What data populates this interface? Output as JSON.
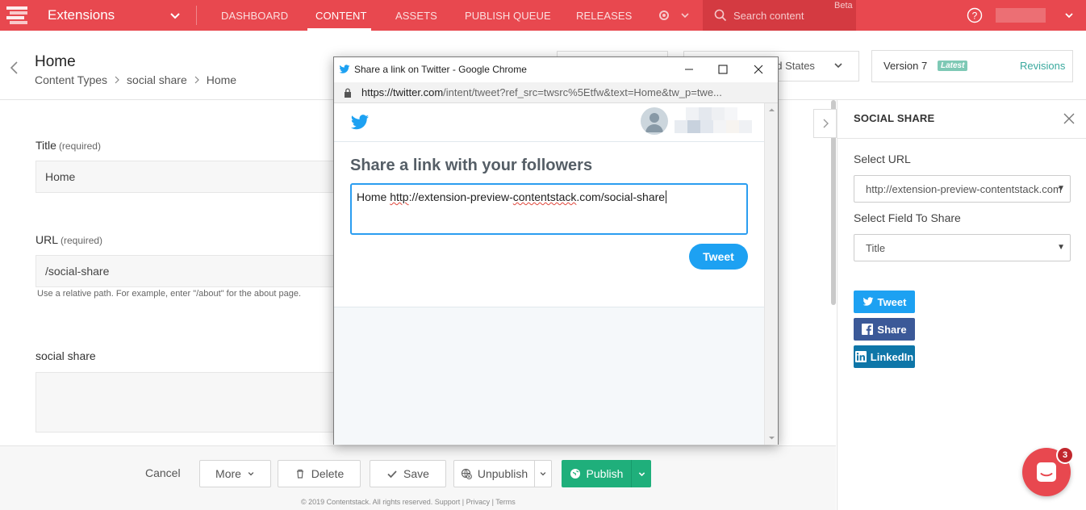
{
  "topnav": {
    "stack_name": "Extensions",
    "items": [
      "DASHBOARD",
      "CONTENT",
      "ASSETS",
      "PUBLISH QUEUE",
      "RELEASES"
    ],
    "active_item": "CONTENT",
    "search_placeholder": "Search content",
    "beta_label": "Beta",
    "brand_color": "#e8484f"
  },
  "header": {
    "title": "Home",
    "breadcrumb": [
      "Content Types",
      "social share",
      "Home"
    ],
    "locale_partial": "ed States",
    "version_label": "Version 7",
    "latest_badge": "Latest",
    "revisions_link": "Revisions"
  },
  "form": {
    "title_label": "Title",
    "title_req": "(required)",
    "title_value": "Home",
    "url_label": "URL",
    "url_req": "(required)",
    "url_value": "/social-share",
    "url_help": "Use a relative path. For example, enter \"/about\" for the about page.",
    "social_label": "social share"
  },
  "footer": {
    "cancel": "Cancel",
    "more": "More",
    "delete": "Delete",
    "save": "Save",
    "unpublish": "Unpublish",
    "publish": "Publish",
    "copyright": "© 2019 Contentstack. All rights reserved. Support | Privacy | Terms"
  },
  "right_panel": {
    "title": "SOCIAL SHARE",
    "select_url_label": "Select URL",
    "select_url_value": "http://extension-preview-contentstack.com",
    "select_field_label": "Select Field To Share",
    "select_field_value": "Title",
    "buttons": {
      "tweet": "Tweet",
      "share": "Share",
      "linkedin": "LinkedIn"
    },
    "colors": {
      "twitter": "#1da1f2",
      "facebook": "#3b5998",
      "linkedin": "#0e76a8"
    }
  },
  "chat": {
    "badge_count": "3"
  },
  "popup": {
    "window_title": "Share a link on Twitter - Google Chrome",
    "url_host": "https://twitter.com",
    "url_path": "/intent/tweet?ref_src=twsrc%5Etfw&text=Home&tw_p=twe...",
    "heading": "Share a link with your followers",
    "tweet_text_prefix": "Home ",
    "tweet_text_link_a": "http",
    "tweet_text_link_b": "://extension-preview-",
    "tweet_text_link_c": "contentstack",
    "tweet_text_link_d": ".com/social-share",
    "tweet_button": "Tweet"
  }
}
